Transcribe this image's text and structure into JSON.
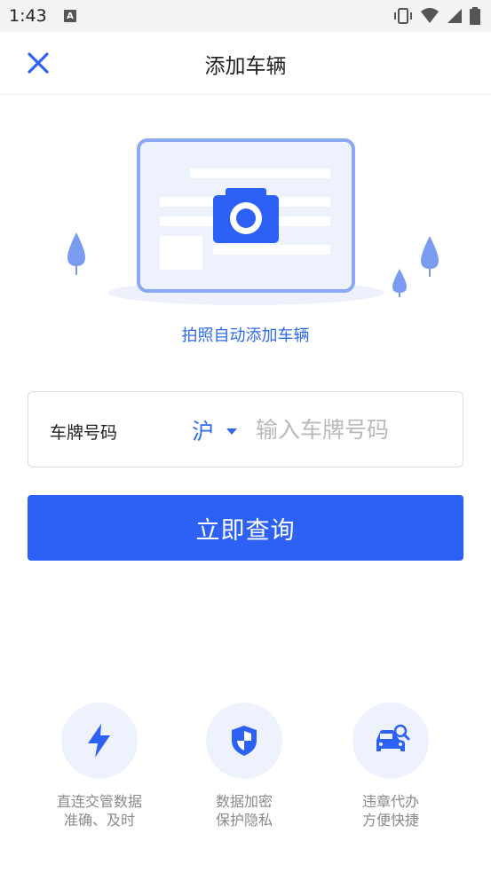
{
  "status_bar": {
    "time": "1:43",
    "notification_letter": "A"
  },
  "nav": {
    "title": "添加车辆",
    "close_icon": "close-icon"
  },
  "illustration": {
    "caption": "拍照自动添加车辆",
    "icon": "camera-card-icon"
  },
  "plate": {
    "label": "车牌号码",
    "province": "沪",
    "placeholder": "输入车牌号码",
    "value": ""
  },
  "query_button": {
    "label": "立即查询"
  },
  "features": [
    {
      "icon": "lightning-icon",
      "line1": "直连交管数据",
      "line2": "准确、及时"
    },
    {
      "icon": "shield-icon",
      "line1": "数据加密",
      "line2": "保护隐私"
    },
    {
      "icon": "car-search-icon",
      "line1": "违章代办",
      "line2": "方便快捷"
    }
  ],
  "colors": {
    "accent": "#2d61f5",
    "link": "#2f6be8",
    "feature_bg": "#eef2fd"
  }
}
